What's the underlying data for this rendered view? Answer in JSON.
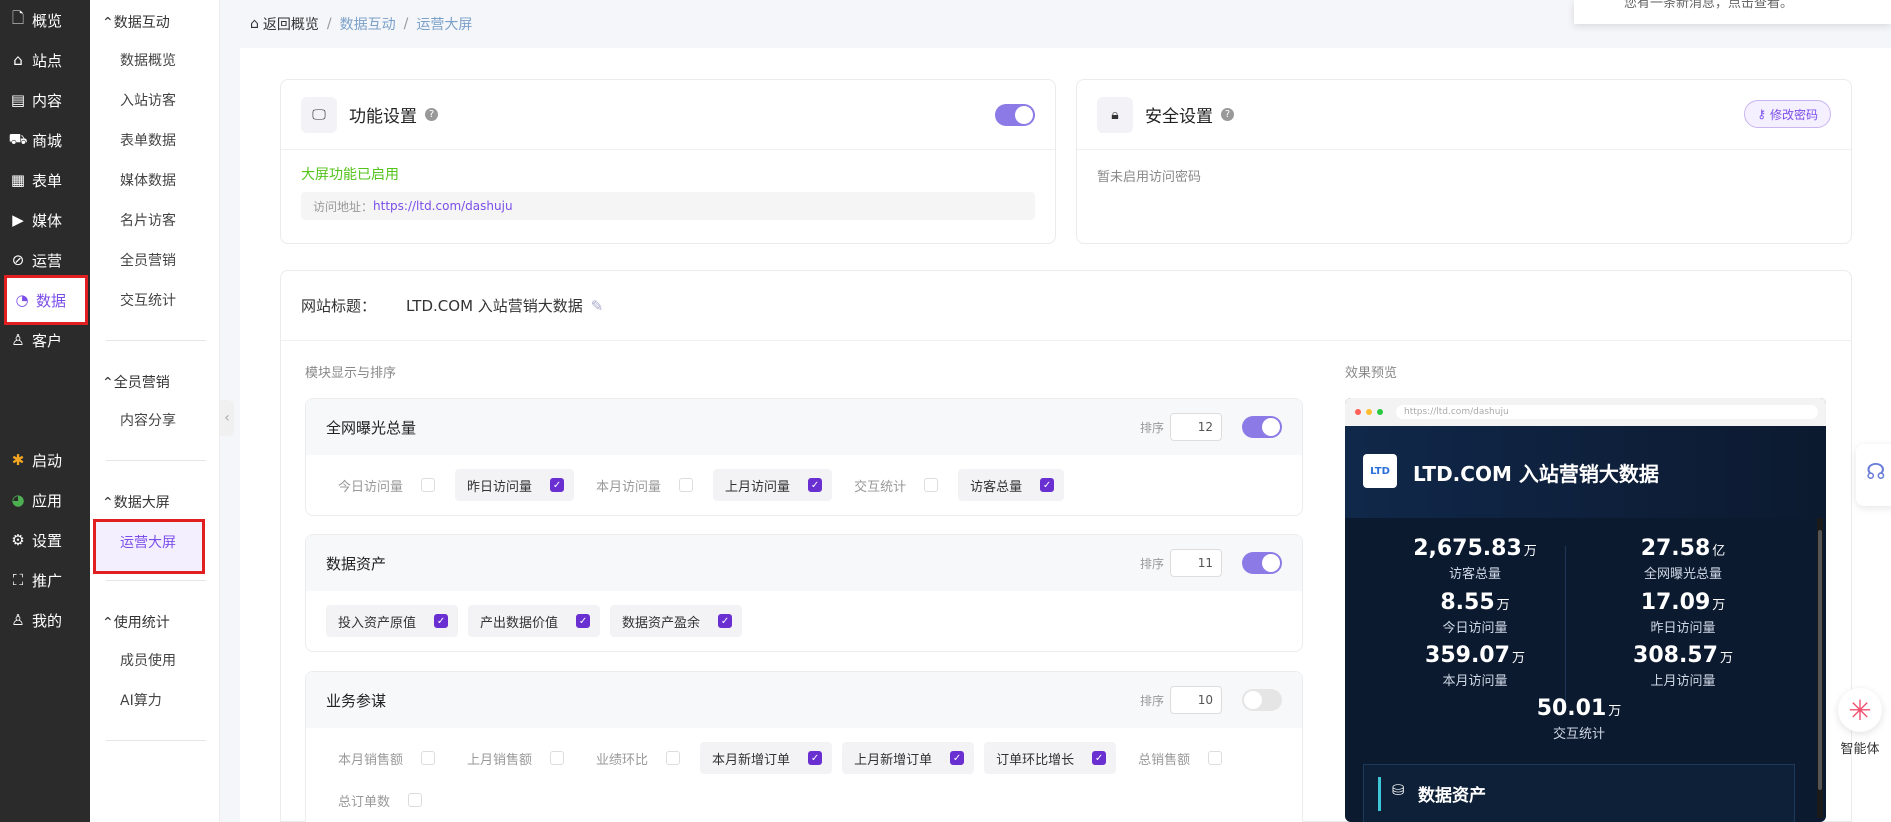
{
  "nav": {
    "items": [
      {
        "label": "概览",
        "icon": "overview-icon"
      },
      {
        "label": "站点",
        "icon": "home-icon"
      },
      {
        "label": "内容",
        "icon": "document-icon"
      },
      {
        "label": "商城",
        "icon": "cart-icon"
      },
      {
        "label": "表单",
        "icon": "form-icon"
      },
      {
        "label": "媒体",
        "icon": "video-icon"
      },
      {
        "label": "运营",
        "icon": "paperclip-icon"
      },
      {
        "label": "数据",
        "icon": "pie-icon"
      },
      {
        "label": "客户",
        "icon": "user-icon"
      }
    ],
    "bottom": [
      {
        "label": "启动",
        "icon": "launch-icon"
      },
      {
        "label": "应用",
        "icon": "apps-icon"
      },
      {
        "label": "设置",
        "icon": "gear-icon"
      },
      {
        "label": "推广",
        "icon": "bag-icon"
      },
      {
        "label": "我的",
        "icon": "profile-icon"
      }
    ]
  },
  "subnav": {
    "g1": "数据互动",
    "g1_items": [
      "数据概览",
      "入站访客",
      "表单数据",
      "媒体数据",
      "名片访客",
      "全员营销",
      "交互统计"
    ],
    "g2": "全员营销",
    "g2_items": [
      "内容分享"
    ],
    "g3": "数据大屏",
    "g3_items": [
      "运营大屏"
    ],
    "g4": "使用统计",
    "g4_items": [
      "成员使用",
      "AI算力"
    ]
  },
  "breadcrumb": {
    "home": "返回概览",
    "c1": "数据互动",
    "c2": "运营大屏",
    "sep": "/"
  },
  "notice": "您有一条新消息，点击查看。",
  "func": {
    "title": "功能设置",
    "enabled_text": "大屏功能已启用",
    "url_label": "访问地址：",
    "url": "https://ltd.com/dashuju"
  },
  "security": {
    "title": "安全设置",
    "button": "修改密码",
    "status": "暂未启用访问密码"
  },
  "site_title": {
    "label": "网站标题：",
    "value": "LTD.COM 入站营销大数据"
  },
  "modules_label": "模块显示与排序",
  "preview_label": "效果预览",
  "sort_label": "排序",
  "modules": [
    {
      "title": "全网曝光总量",
      "sort": "12",
      "enabled": true,
      "chips": [
        {
          "label": "今日访问量",
          "checked": false
        },
        {
          "label": "昨日访问量",
          "checked": true
        },
        {
          "label": "本月访问量",
          "checked": false
        },
        {
          "label": "上月访问量",
          "checked": true
        },
        {
          "label": "交互统计",
          "checked": false
        },
        {
          "label": "访客总量",
          "checked": true
        }
      ]
    },
    {
      "title": "数据资产",
      "sort": "11",
      "enabled": true,
      "chips": [
        {
          "label": "投入资产原值",
          "checked": true
        },
        {
          "label": "产出数据价值",
          "checked": true
        },
        {
          "label": "数据资产盈余",
          "checked": true
        }
      ]
    },
    {
      "title": "业务参谋",
      "sort": "10",
      "enabled": false,
      "chips": [
        {
          "label": "本月销售额",
          "checked": false
        },
        {
          "label": "上月销售额",
          "checked": false
        },
        {
          "label": "业绩环比",
          "checked": false
        },
        {
          "label": "本月新增订单",
          "checked": true
        },
        {
          "label": "上月新增订单",
          "checked": true
        },
        {
          "label": "订单环比增长",
          "checked": true
        },
        {
          "label": "总销售额",
          "checked": false
        },
        {
          "label": "总订单数",
          "checked": false
        }
      ]
    }
  ],
  "preview": {
    "url": "https://ltd.com/dashuju",
    "logo_text": "LTD",
    "title": "LTD.COM 入站营销大数据",
    "stats": [
      {
        "num": "2,675.83",
        "unit": "万",
        "label": "访客总量"
      },
      {
        "num": "27.58",
        "unit": "亿",
        "label": "全网曝光总量"
      },
      {
        "num": "8.55",
        "unit": "万",
        "label": "今日访问量"
      },
      {
        "num": "17.09",
        "unit": "万",
        "label": "昨日访问量"
      },
      {
        "num": "359.07",
        "unit": "万",
        "label": "本月访问量"
      },
      {
        "num": "308.57",
        "unit": "万",
        "label": "上月访问量"
      },
      {
        "num": "50.01",
        "unit": "万",
        "label": "交互统计"
      }
    ],
    "section": "数据资产"
  },
  "agent": "智能体"
}
